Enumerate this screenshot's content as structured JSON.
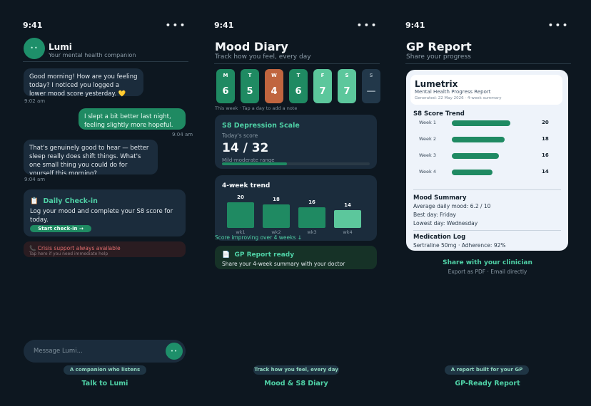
{
  "status": {
    "time": "9:41",
    "menu": "•••"
  },
  "chat": {
    "bot_name": "Lumi",
    "bot_subtitle": "Your mental health companion",
    "avatar_glyph": "••",
    "messages": [
      {
        "from": "bot",
        "text": "Good morning! How are you feeling today? I noticed you logged a lower mood score yesterday. 💛",
        "time": "9:02 am"
      },
      {
        "from": "user",
        "text": "I slept a bit better last night, feeling slightly more hopeful.",
        "time": "9:04 am"
      },
      {
        "from": "bot",
        "text": "That's genuinely good to hear — better sleep really does shift things. What's one small thing you could do for yourself this morning?",
        "time": "9:04 am"
      }
    ],
    "checkin": {
      "icon": "📋",
      "title": "Daily Check-in",
      "body": "Log your mood and complete your S8 score for today.",
      "button": "Start check-in →"
    },
    "crisis": {
      "icon": "📞",
      "title": "Crisis support always available",
      "subtitle": "Tap here if you need immediate help"
    },
    "input_placeholder": "Message Lumi...",
    "send_glyph": "••",
    "footer_pill": "A companion who listens",
    "footer_title": "Talk to Lumi"
  },
  "diary": {
    "title": "Mood Diary",
    "subtitle": "Track how you feel, every day",
    "days": [
      {
        "letter": "M",
        "value": "6",
        "color": "#1f8a62",
        "text": "#ffffff"
      },
      {
        "letter": "T",
        "value": "5",
        "color": "#1f8a62",
        "text": "#ffffff"
      },
      {
        "letter": "W",
        "value": "4",
        "color": "#c0653f",
        "text": "#ffffff"
      },
      {
        "letter": "T",
        "value": "6",
        "color": "#1f8a62",
        "text": "#ffffff"
      },
      {
        "letter": "F",
        "value": "7",
        "color": "#5cc79c",
        "text": "#ffffff"
      },
      {
        "letter": "S",
        "value": "7",
        "color": "#5cc79c",
        "text": "#ffffff"
      },
      {
        "letter": "S",
        "value": "—",
        "color": "#22384a",
        "text": "#8a9aa6"
      }
    ],
    "week_note": "This week  ·  Tap a day to add a note",
    "s8": {
      "title": "S8 Depression Scale",
      "label": "Today's score",
      "score": "14 / 32",
      "severity": "Mild-moderate range",
      "fraction": 0.4375
    },
    "trend": {
      "title": "4-week trend",
      "note": "Score improving over 4 weeks ↓"
    },
    "gp_card": {
      "icon": "📄",
      "title": "GP Report ready",
      "subtitle": "Share your 4-week summary with your doctor"
    },
    "footer_pill": "Track how you feel, every day",
    "footer_title": "Mood & S8 Diary"
  },
  "chart_data": {
    "type": "bar",
    "title": "4-week trend",
    "categories": [
      "wk1",
      "wk2",
      "wk3",
      "wk4"
    ],
    "values": [
      20,
      18,
      16,
      14
    ],
    "colors": [
      "#1f8a62",
      "#1f8a62",
      "#1f8a62",
      "#5cc79c"
    ],
    "ylim": [
      0,
      32
    ]
  },
  "report": {
    "title": "GP Report",
    "subtitle": "Share your progress",
    "brand": "Lumetrix",
    "report_title": "Mental Health Progress Report",
    "generated": "Generated: 22 May 2026  ·  4-week summary",
    "s8_title": "S8 Score Trend",
    "weeks": [
      {
        "label": "Week 1",
        "value": 20
      },
      {
        "label": "Week 2",
        "value": 18
      },
      {
        "label": "Week 3",
        "value": 16
      },
      {
        "label": "Week 4",
        "value": 14
      }
    ],
    "mood_title": "Mood Summary",
    "mood_lines": [
      "Average daily mood:  6.2 / 10",
      "Best day:  Friday",
      "Lowest day:  Wednesday"
    ],
    "med_title": "Medication Log",
    "med_line": "Sertraline 50mg  ·  Adherence: 92%",
    "share_title": "Share with your clinician",
    "share_sub": "Export as PDF  ·  Email directly",
    "footer_pill": "A report built for your GP",
    "footer_title": "GP-Ready Report"
  }
}
